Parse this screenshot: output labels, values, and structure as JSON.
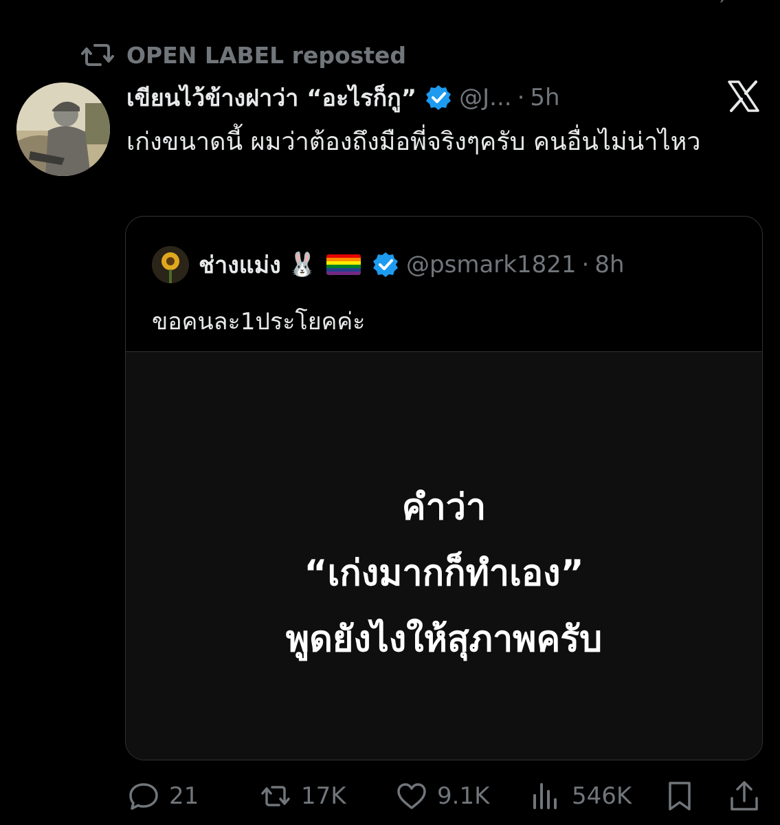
{
  "repost": {
    "text": "OPEN LABEL reposted"
  },
  "tweet": {
    "name": "เขียนไว้ข้างฝาว่า “อะไรก็กู”",
    "handle": "@J...",
    "separator": "·",
    "time": "5h",
    "text": "เก่งขนาดนี้ ผมว่าต้องถึงมือพี่จริงๆครับ คนอื่นไม่น่าไหว"
  },
  "quote": {
    "name": "ช่างแม่ง",
    "emoji": "🐰",
    "handle": "@psmark1821",
    "separator": "·",
    "time": "8h",
    "text": "ขอคนละ1ประโยคค่ะ",
    "media_lines": [
      "คำว่า",
      "“เก่งมากก็ทำเอง”",
      "พูดยังไงให้สุภาพครับ"
    ]
  },
  "actions": {
    "replies": "21",
    "reposts": "17K",
    "likes": "9.1K",
    "views": "546K"
  },
  "colors": {
    "background": "#000000",
    "text": "#e7e9ea",
    "muted": "#71767b",
    "verified": "#1d9bf0",
    "border": "#2f3336"
  },
  "icons": [
    "repost-icon",
    "verified-badge-icon",
    "x-logo-icon",
    "reply-icon",
    "retweet-icon",
    "like-icon",
    "views-icon",
    "bookmark-icon",
    "share-icon"
  ]
}
